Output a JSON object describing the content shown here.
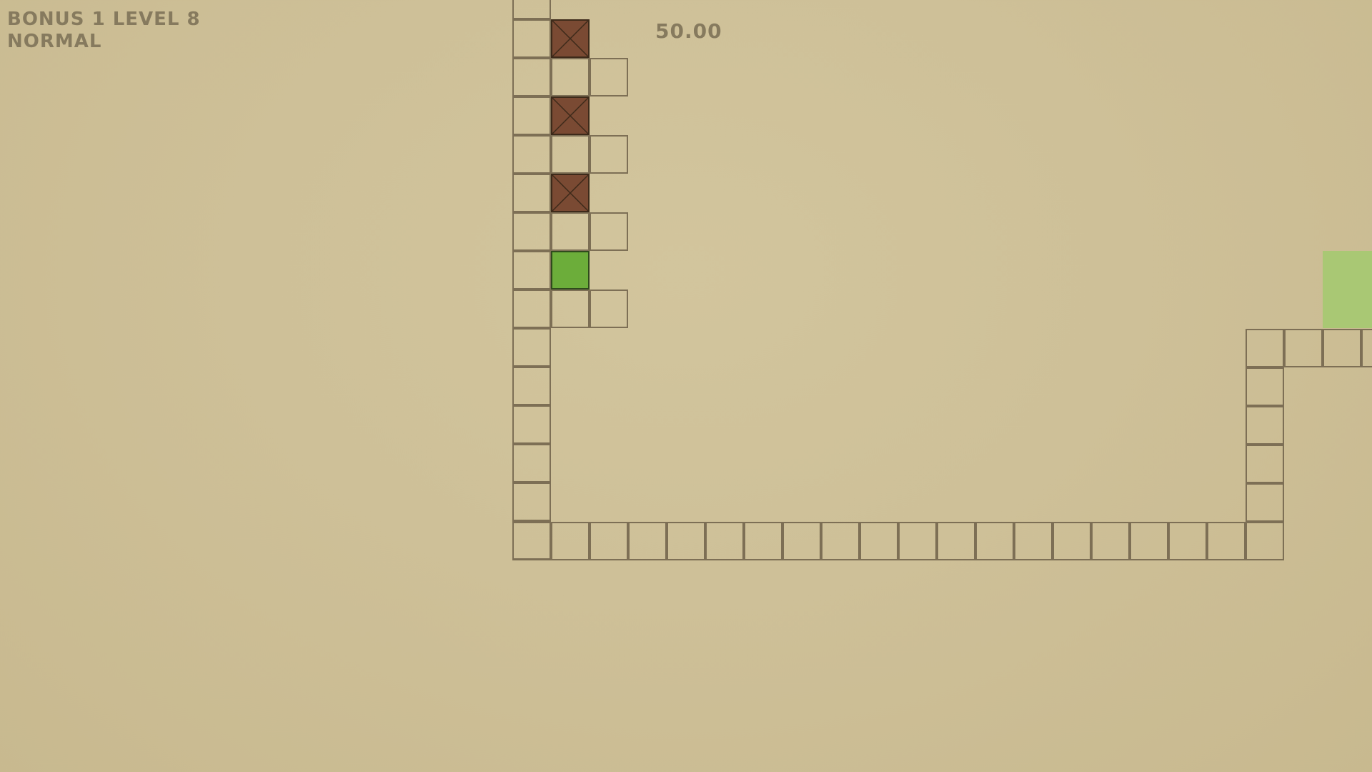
{
  "hud": {
    "level_label": "BONUS 1 LEVEL 8",
    "difficulty": "NORMAL",
    "timer": "50.00"
  },
  "colors": {
    "background": "#cfc29a",
    "wall_outline": "#7d6f55",
    "crate": "#7a4a33",
    "player": "#6cad3a",
    "exit": "#a9c874",
    "hud_text": "#867a5e"
  },
  "level": {
    "map": [
      ".............",
      "......X......",
      ".....###.....",
      "......X......",
      ".....###.....",
      "......X......",
      ".....###.....",
      "......P......",
      ".....###.....",
      "............."
    ],
    "legend": {
      "#": "wall-block",
      "X": "wooden-crate",
      "P": "player-block",
      "E": "exit-zone"
    }
  }
}
